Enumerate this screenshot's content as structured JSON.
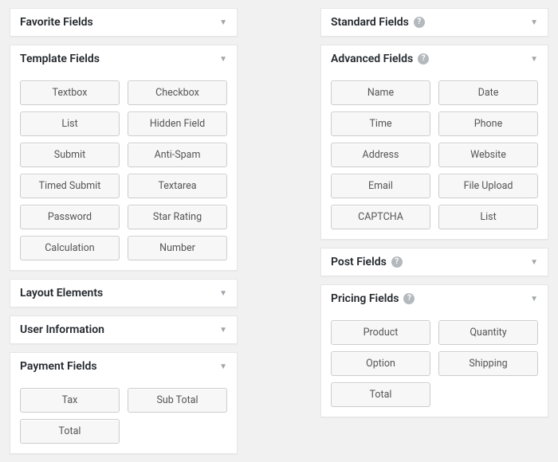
{
  "left_panels": [
    {
      "id": "favorite",
      "title": "Favorite Fields",
      "help": false,
      "expanded": false,
      "items": []
    },
    {
      "id": "template",
      "title": "Template Fields",
      "help": false,
      "expanded": true,
      "items": [
        "Textbox",
        "Checkbox",
        "List",
        "Hidden Field",
        "Submit",
        "Anti-Spam",
        "Timed Submit",
        "Textarea",
        "Password",
        "Star Rating",
        "Calculation",
        "Number"
      ]
    },
    {
      "id": "layout",
      "title": "Layout Elements",
      "help": false,
      "expanded": false,
      "items": []
    },
    {
      "id": "userinfo",
      "title": "User Information",
      "help": false,
      "expanded": false,
      "items": []
    },
    {
      "id": "payment",
      "title": "Payment Fields",
      "help": false,
      "expanded": true,
      "items": [
        "Tax",
        "Sub Total",
        "Total"
      ]
    }
  ],
  "right_panels": [
    {
      "id": "standard",
      "title": "Standard Fields",
      "help": true,
      "expanded": false,
      "items": []
    },
    {
      "id": "advanced",
      "title": "Advanced Fields",
      "help": true,
      "expanded": true,
      "items": [
        "Name",
        "Date",
        "Time",
        "Phone",
        "Address",
        "Website",
        "Email",
        "File Upload",
        "CAPTCHA",
        "List"
      ]
    },
    {
      "id": "post",
      "title": "Post Fields",
      "help": true,
      "expanded": false,
      "items": []
    },
    {
      "id": "pricing",
      "title": "Pricing Fields",
      "help": true,
      "expanded": true,
      "items": [
        "Product",
        "Quantity",
        "Option",
        "Shipping",
        "Total"
      ]
    }
  ],
  "glyphs": {
    "help": "?",
    "toggle": "▼"
  }
}
